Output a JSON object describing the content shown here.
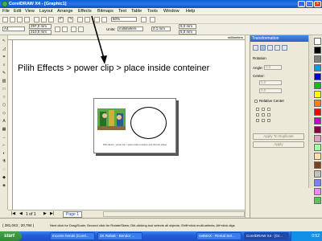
{
  "window": {
    "title": "CorelDRAW X4 - [Graphic1]"
  },
  "menu": [
    "File",
    "Edit",
    "View",
    "Layout",
    "Arrange",
    "Effects",
    "Bitmaps",
    "Text",
    "Table",
    "Tools",
    "Window",
    "Help"
  ],
  "toolbar2": {
    "paper": "A4",
    "width": "297,0 mm",
    "height": "210,0 mm",
    "zoom": "50%",
    "units_label": "Units:",
    "units": "millimeters",
    "nudge": "0,1 mm",
    "dup1": "5,0 mm",
    "dup2": "5,0 mm"
  },
  "ruler_unit": "millimeters",
  "annotation": "Pilih Effects > power clip > place inside conteiner",
  "page_caption": "Pilih effects > power clip > place inside container and click the ellipse",
  "page_nav": {
    "count": "1 of 1",
    "tab": "Page 1"
  },
  "docker": {
    "title": "Transformation",
    "rotation": "Rotation",
    "angle_label": "Angle:",
    "angle": "0,0",
    "center": "Center:",
    "cx": "0,0",
    "cy": "0,0",
    "relative": "Relative Center",
    "apply_dup": "Apply To Duplicate",
    "apply": "Apply"
  },
  "palette_colors": [
    "#ffffff",
    "#000000",
    "#7f7f7f",
    "#00a0e0",
    "#0000c8",
    "#00c800",
    "#ffff00",
    "#ff8000",
    "#ff0000",
    "#c800c8",
    "#800040",
    "#e0a0c0",
    "#a0ffa0",
    "#ffe0a0",
    "#804020",
    "#c0c0c0",
    "#8080ff",
    "#ff80ff",
    "#60c060"
  ],
  "status": {
    "coords": "( 281,043 ; 20,784 )",
    "hint": "Next click for Drag/Scale; Second click for Rotate/Skew; Dbl-clicking tool selects all objects; Shift+click multi-selects; Alt+click digs"
  },
  "taskbar": {
    "start": "start",
    "tasks": [
      "Income heruki (Corel...",
      "2K Rahak - Bendor ...",
      "netMAX - Rental Set...",
      "CorelDRAW X4 - [Gr..."
    ],
    "clock": "0:52"
  }
}
